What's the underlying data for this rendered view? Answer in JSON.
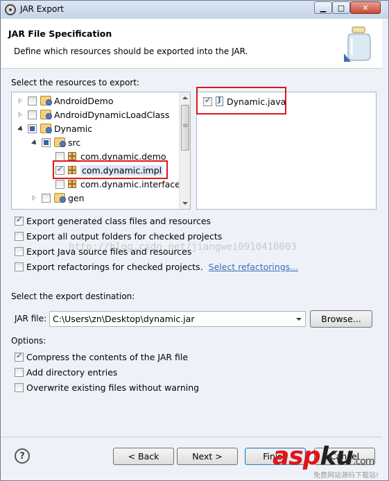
{
  "window": {
    "title": "JAR Export",
    "min_glyph": "▁",
    "max_glyph": "□",
    "close_glyph": "✕"
  },
  "header": {
    "title": "JAR File Specification",
    "description": "Define which resources should be exported into the JAR."
  },
  "resources": {
    "label": "Select the resources to export:",
    "tree": [
      {
        "label": "AndroidDemo",
        "expander": "closed",
        "checkbox": "unchecked",
        "icon": "project-icon"
      },
      {
        "label": "AndroidDynamicLoadClass",
        "expander": "closed",
        "checkbox": "unchecked",
        "icon": "project-icon"
      },
      {
        "label": "Dynamic",
        "expander": "open",
        "checkbox": "partial",
        "icon": "project-icon"
      },
      {
        "label": "src",
        "expander": "open",
        "checkbox": "partial",
        "icon": "source-folder-icon"
      },
      {
        "label": "com.dynamic.demo",
        "expander": "none",
        "checkbox": "unchecked",
        "icon": "package-icon"
      },
      {
        "label": "com.dynamic.impl",
        "expander": "none",
        "checkbox": "checked",
        "icon": "package-icon",
        "selected": true
      },
      {
        "label": "com.dynamic.interfaces",
        "expander": "none",
        "checkbox": "unchecked",
        "icon": "package-icon"
      },
      {
        "label": "gen",
        "expander": "closed",
        "checkbox": "unchecked",
        "icon": "source-folder-icon"
      }
    ],
    "files": [
      {
        "label": "Dynamic.java",
        "checkbox": "checked",
        "icon": "java-file-icon"
      }
    ]
  },
  "options_top": {
    "export_class_files": {
      "label": "Export generated class files and resources",
      "checked": true
    },
    "export_output_folders": {
      "label": "Export all output folders for checked projects",
      "checked": false
    },
    "export_java_source": {
      "label": "Export Java source files and resources",
      "checked": false
    },
    "export_refactorings": {
      "label": "Export refactorings for checked projects.",
      "checked": false
    },
    "select_refactorings_link": "Select refactorings..."
  },
  "destination": {
    "label": "Select the export destination:",
    "jar_file_label": "JAR file:",
    "jar_file_value": "C:\\Users\\zn\\Desktop\\dynamic.jar",
    "browse_label": "Browse..."
  },
  "options": {
    "label": "Options:",
    "compress": {
      "label": "Compress the contents of the JAR file",
      "checked": true
    },
    "directory_entries": {
      "label": "Add directory entries",
      "checked": false
    },
    "overwrite": {
      "label": "Overwrite existing files without warning",
      "checked": false
    }
  },
  "footer": {
    "back_label": "< Back",
    "next_label": "Next >",
    "finish_label": "Finish",
    "cancel_label": "Cancel",
    "help_glyph": "?"
  },
  "watermarks": {
    "url_overlay": "http://blog.csdn.net/jiangwei0910410003",
    "logo_asp": "asp",
    "logo_ku": "ku",
    "logo_dotcom": ".com",
    "logo_tagline": "免费网站源码下载站!"
  },
  "colors": {
    "highlight_box": "#e0141b",
    "link": "#3e6bb4",
    "dialog_background": "#eef2f8"
  }
}
